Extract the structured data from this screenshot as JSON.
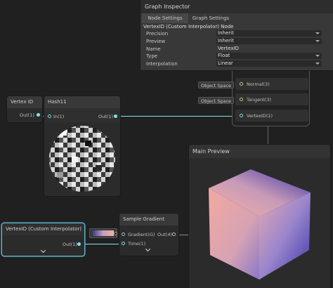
{
  "inspector": {
    "title": "Graph Inspector",
    "tabs": [
      "Node Settings",
      "Graph Settings"
    ],
    "section": "VertexID (Custom Interpolator) Node",
    "rows": [
      {
        "label": "Precision",
        "value": "Inherit"
      },
      {
        "label": "Preview",
        "value": "Inherit"
      },
      {
        "label": "Name",
        "value": "VertexID"
      },
      {
        "label": "Type",
        "value": "Float"
      },
      {
        "label": "Interpolation",
        "value": "Linear"
      }
    ]
  },
  "vertex_block": {
    "ports": [
      "Normal(3)",
      "Tangent(3)",
      "VertexID(1)"
    ],
    "fields": [
      "Object Space",
      "Object Space"
    ]
  },
  "vertex_id_node": {
    "title": "Vertex ID",
    "out": "Out(1)"
  },
  "hash_node": {
    "title": "Hash11",
    "in": "In(1)",
    "out": "Out(1)"
  },
  "custom_interp_node": {
    "title": "VertexID (Custom Interpolator)",
    "out": "Out(1)"
  },
  "gradient_node": {
    "title": "Sample Gradient",
    "in1": "Gradient(G)",
    "in2": "Time(1)",
    "out": "Out(4)"
  },
  "main_preview": {
    "title": "Main Preview"
  },
  "colors": {
    "accent": "#84e4e7",
    "cube_top": "#f0a8a4",
    "cube_side": "#4a3fb0"
  }
}
